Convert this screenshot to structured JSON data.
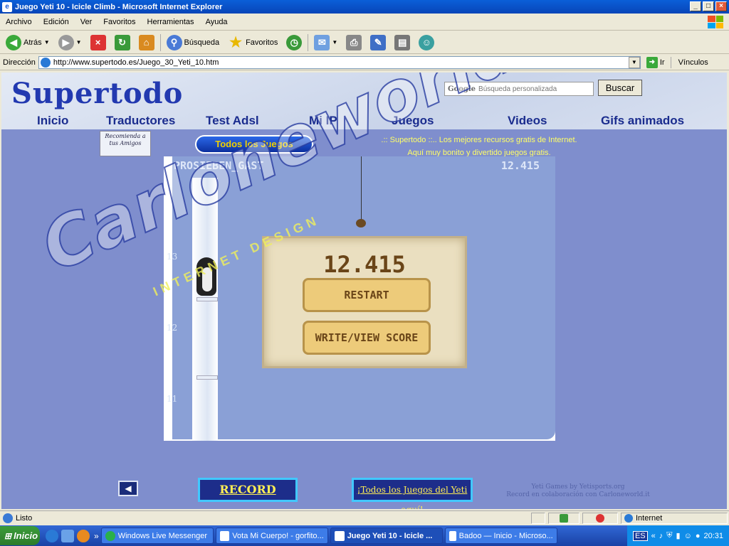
{
  "window": {
    "title": "Juego Yeti 10 - Icicle Climb - Microsoft Internet Explorer"
  },
  "menu": [
    "Archivo",
    "Edición",
    "Ver",
    "Favoritos",
    "Herramientas",
    "Ayuda"
  ],
  "toolbar": {
    "back": "Atrás",
    "search": "Búsqueda",
    "favorites": "Favoritos"
  },
  "address": {
    "label": "Dirección",
    "url": "http://www.supertodo.es/Juego_30_Yeti_10.htm",
    "go": "Ir",
    "links": "Vínculos"
  },
  "site": {
    "logo": "Supertodo",
    "search_brand": "Google",
    "search_placeholder": "Búsqueda personalizada",
    "search_button": "Buscar",
    "nav": [
      "Inicio",
      "Traductores",
      "Test Adsl",
      "Mi IP",
      "Juegos",
      "Videos",
      "Gifs animados"
    ],
    "recommend": "Recomienda a tus Amigos",
    "all_games": "Todos los Juegos",
    "tagline_1": ".:: Supertodo ::.. Los mejores recursos gratis de Internet.",
    "tagline_2": "Aquí muy bonito y divertido juegos gratis."
  },
  "game": {
    "player": "PROSIEBEN_GAST",
    "score_top": "12.415",
    "score_sign": "12.415",
    "restart": "RESTART",
    "write_score": "WRITE/VIEW SCORE",
    "altitudes": [
      "13",
      "12",
      "11"
    ]
  },
  "bottom": {
    "record": "RECORD",
    "yeti_link": "¡Todos los Juegos del Yeti aquí!",
    "credit_1": "Yeti Games by Yetisports.org",
    "credit_2": "Record en colaboración con Carloneworld.it"
  },
  "watermark": {
    "main": "Carloneworld.it",
    "sub": "INTERNET DESIGN"
  },
  "status": {
    "text": "Listo",
    "zone": "Internet"
  },
  "taskbar": {
    "start": "Inicio",
    "tasks": [
      "Windows Live Messenger",
      "Vota Mi Cuerpo! - gorfito...",
      "Juego Yeti 10 - Icicle ...",
      "Badoo — Inicio - Microso..."
    ],
    "lang": "ES",
    "clock": "20:31"
  },
  "colors": {
    "title_blue": "#0a5fd8",
    "page_blue": "#7f8ecd",
    "nav_blue": "#1a2c8e",
    "accent_yellow": "#ffee55"
  }
}
